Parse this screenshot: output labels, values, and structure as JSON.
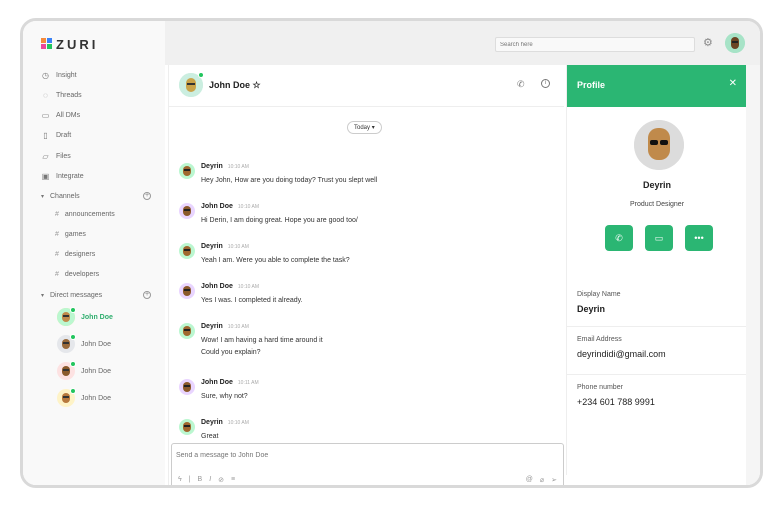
{
  "brand": {
    "name": "ZURI"
  },
  "sidebar": {
    "nav": [
      {
        "label": "Insight",
        "icon": "clock-icon"
      },
      {
        "label": "Threads",
        "icon": "thread-icon"
      },
      {
        "label": "All DMs",
        "icon": "message-icon"
      },
      {
        "label": "Draft",
        "icon": "draft-icon"
      },
      {
        "label": "Files",
        "icon": "file-icon"
      },
      {
        "label": "Integrate",
        "icon": "integrate-icon"
      }
    ],
    "channels_label": "Channels",
    "channels": [
      "announcements",
      "games",
      "designers",
      "developers"
    ],
    "dms_label": "Direct messages",
    "dms": [
      "John Doe",
      "John Doe",
      "John Doe",
      "John Doe"
    ]
  },
  "topbar": {
    "search_placeholder": "Search here"
  },
  "chat": {
    "contact_name": "John Doe",
    "star": "☆",
    "date_label": "Today",
    "messages": [
      {
        "author": "Deyrin",
        "time": "10:10 AM",
        "lines": [
          "Hey John, How are you doing today? Trust you slept well"
        ]
      },
      {
        "author": "John Doe",
        "time": "10:10 AM",
        "lines": [
          "Hi Derin, I am doing great. Hope you are good too/"
        ]
      },
      {
        "author": "Deyrin",
        "time": "10:10 AM",
        "lines": [
          "Yeah I am. Were you able to complete the task?"
        ]
      },
      {
        "author": "John Doe",
        "time": "10:10 AM",
        "lines": [
          "Yes I was. I completed it already."
        ]
      },
      {
        "author": "Deyrin",
        "time": "10:10 AM",
        "lines": [
          "Wow! I am having a hard time around it",
          "Could you explain?"
        ]
      },
      {
        "author": "John Doe",
        "time": "10:11 AM",
        "lines": [
          "Sure, why not?"
        ]
      },
      {
        "author": "Deyrin",
        "time": "10:10 AM",
        "lines": [
          "Great"
        ]
      }
    ],
    "composer_placeholder": "Send a message to John Doe"
  },
  "profile": {
    "title": "Profile",
    "name": "Deyrin",
    "role": "Product Designer",
    "display_name_label": "Display Name",
    "display_name": "Deyrin",
    "email_label": "Email Address",
    "email": "deyrindidi@gmail.com",
    "phone_label": "Phone number",
    "phone": "+234 601 788 9991"
  },
  "colors": {
    "accent": "#2bb673",
    "online": "#22c55e"
  }
}
